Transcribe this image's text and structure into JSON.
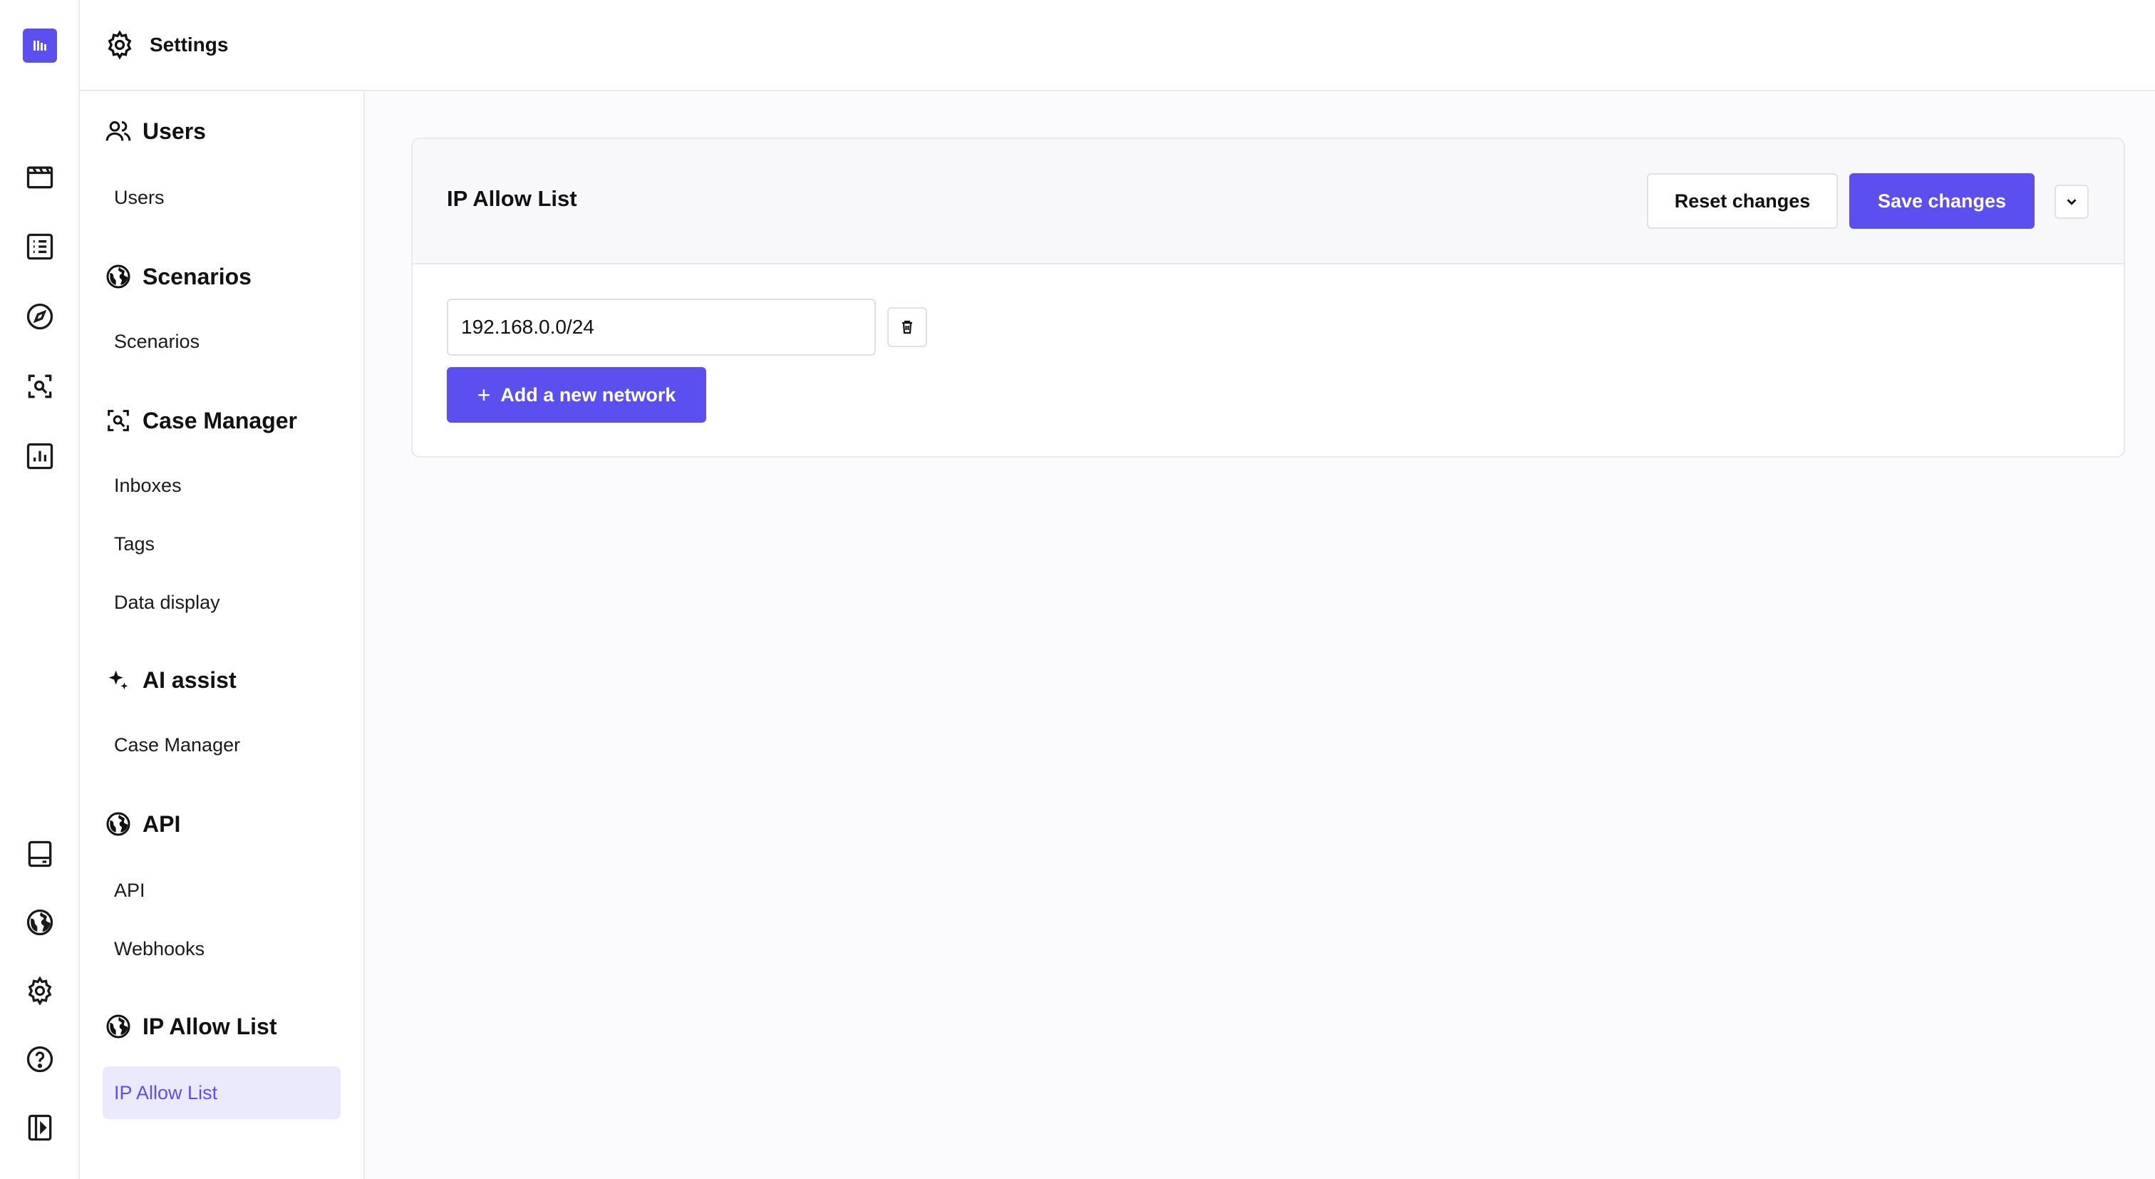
{
  "topbar": {
    "title": "Settings"
  },
  "sidebar": {
    "sections": [
      {
        "title": "Users",
        "items": [
          "Users"
        ]
      },
      {
        "title": "Scenarios",
        "items": [
          "Scenarios"
        ]
      },
      {
        "title": "Case Manager",
        "items": [
          "Inboxes",
          "Tags",
          "Data display"
        ]
      },
      {
        "title": "AI assist",
        "items": [
          "Case Manager"
        ]
      },
      {
        "title": "API",
        "items": [
          "API",
          "Webhooks"
        ]
      },
      {
        "title": "IP Allow List",
        "items": [
          "IP Allow List"
        ]
      }
    ],
    "active_item": "IP Allow List"
  },
  "panel": {
    "title": "IP Allow List",
    "reset_label": "Reset changes",
    "save_label": "Save changes",
    "networks": [
      "192.168.0.0/24"
    ],
    "add_label": "Add a new network"
  },
  "rail": {
    "icons": [
      "clapperboard-icon",
      "list-icon",
      "compass-icon",
      "scan-icon",
      "chart-icon",
      "panel-icon",
      "globe-icon",
      "gear-icon",
      "help-icon",
      "sidebar-toggle-icon"
    ]
  },
  "colors": {
    "accent": "#5b4ff0",
    "active_bg": "#ebeafc"
  }
}
